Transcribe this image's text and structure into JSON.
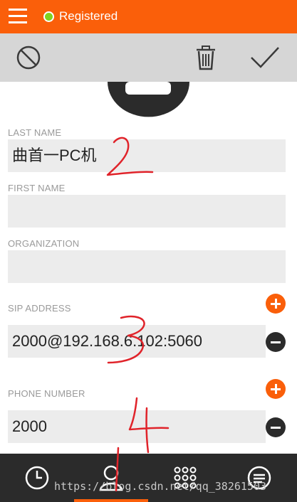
{
  "status": {
    "label": "Registered"
  },
  "toolbar": {
    "icons": [
      "cancel-icon",
      "delete-icon",
      "confirm-icon"
    ]
  },
  "fields": {
    "last_name": {
      "label": "LAST NAME",
      "value": "曲首一PC机"
    },
    "first_name": {
      "label": "FIRST NAME",
      "value": ""
    },
    "organization": {
      "label": "ORGANIZATION",
      "value": ""
    },
    "sip_address": {
      "label": "SIP ADDRESS",
      "value": "2000@192.168.6.102:5060"
    },
    "phone_number": {
      "label": "PHONE NUMBER",
      "value": "2000"
    }
  },
  "tabs": [
    "history-icon",
    "contacts-icon",
    "dialer-icon",
    "chat-icon"
  ],
  "watermark": "https://blog.csdn.net/qq_38261503",
  "handwritten_annotations": [
    "2",
    "3",
    "4",
    "1"
  ],
  "colors": {
    "accent": "#fa5f0a",
    "registered": "#7ed321",
    "tabbar": "#2b2b2b",
    "toolbar": "#d6d6d6"
  }
}
